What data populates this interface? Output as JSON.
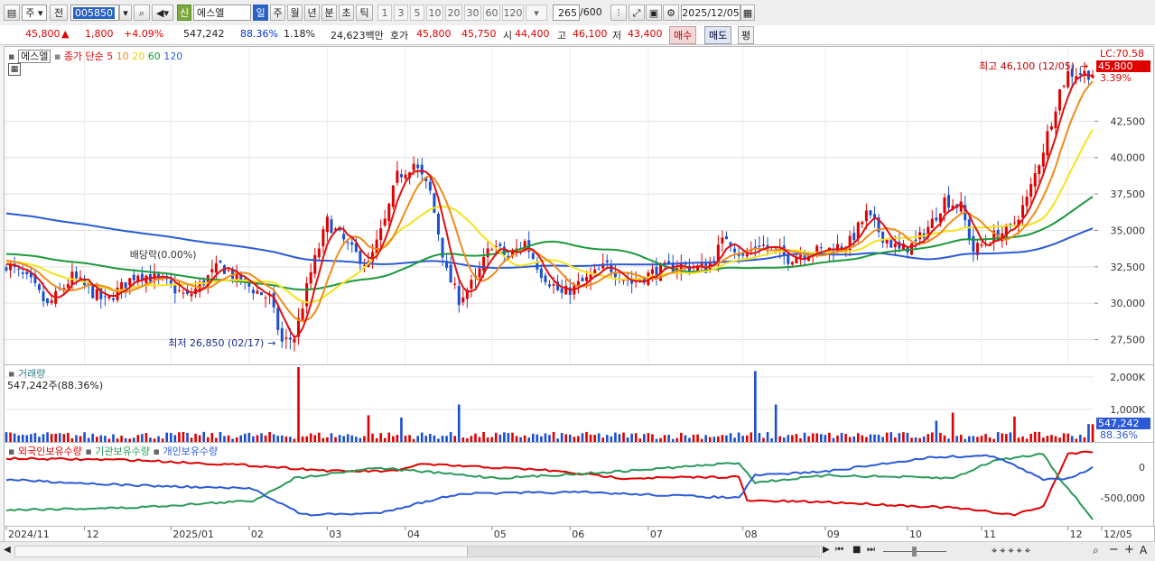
{
  "toolbar": {
    "type_label": "주",
    "jeon_label": "전",
    "code": "005850",
    "badge": "신",
    "name": "에스엘",
    "periods": [
      "일",
      "주",
      "월",
      "년",
      "분",
      "초",
      "틱"
    ],
    "active_period": "일",
    "minutes": [
      "1",
      "3",
      "5",
      "10",
      "20",
      "30",
      "60",
      "120"
    ],
    "count": "265",
    "count_total": "/600",
    "date": "2025/12/05"
  },
  "quote": {
    "price": "45,800",
    "arrow": "▲",
    "change": "1,800",
    "change_pct": "+4.09%",
    "volume": "547,242",
    "vol_ratio": "88.36%",
    "turnover": "1.18%",
    "amount": "24,623백만",
    "hoga_label": "호가",
    "ask": "45,800",
    "bid": "45,750",
    "open_label": "시",
    "open": "44,400",
    "high_label": "고",
    "high": "46,100",
    "low_label": "저",
    "low": "43,400",
    "buy_label": "매수",
    "sell_label": "매도",
    "eval_label": "평"
  },
  "legend_main": {
    "name": "에스엘",
    "ma_label": "종가 단순",
    "ma": [
      "5",
      "10",
      "20",
      "60",
      "120"
    ]
  },
  "annotations": {
    "lc": "LC:70.58",
    "high_note": "최고 46,100 (12/05)",
    "low_note": "최저 26,850 (02/17)",
    "dividend": "배당락(0.00%)",
    "last_price": "45,800",
    "last_pct": "3.39%"
  },
  "volume_panel": {
    "title": "거래량",
    "summary": "547,242주(88.36%)",
    "last": "547,242",
    "last_pct": "88.36%"
  },
  "holding_panel": {
    "legend": [
      "외국인보유수량",
      "기관보유수량",
      "개인보유수량"
    ]
  },
  "colors": {
    "up": "#e00000",
    "down": "#1a4fd0",
    "ma5": "#e01010",
    "ma10": "#f08c1a",
    "ma20": "#f5e31a",
    "ma60": "#1a9a3a",
    "ma120": "#2a5ad8",
    "foreign": "#e00000",
    "institution": "#2a9a5a",
    "individual": "#2a5ad8"
  },
  "chart_data": [
    {
      "type": "candlestick",
      "title": "에스엘",
      "y_ticks": [
        27500,
        30000,
        32500,
        35000,
        37500,
        40000,
        42500
      ],
      "y_tick_labels": [
        "27,500",
        "30,000",
        "32,500",
        "35,000",
        "37,500",
        "40,000",
        "42,500"
      ],
      "ylim": [
        25800,
        47600
      ],
      "x_ticks": [
        {
          "i": 0,
          "label": "2024/11"
        },
        {
          "i": 19,
          "label": "12"
        },
        {
          "i": 40,
          "label": "2025/01"
        },
        {
          "i": 59,
          "label": "02"
        },
        {
          "i": 78,
          "label": "03"
        },
        {
          "i": 97,
          "label": "04"
        },
        {
          "i": 118,
          "label": "05"
        },
        {
          "i": 137,
          "label": "06"
        },
        {
          "i": 156,
          "label": "07"
        },
        {
          "i": 179,
          "label": "08"
        },
        {
          "i": 199,
          "label": "09"
        },
        {
          "i": 219,
          "label": "10"
        },
        {
          "i": 237,
          "label": "11"
        },
        {
          "i": 258,
          "label": "12"
        },
        {
          "i": 270,
          "label": "12/05"
        }
      ],
      "close_anchors": [
        [
          0,
          32700
        ],
        [
          6,
          31400
        ],
        [
          10,
          29800
        ],
        [
          16,
          31800
        ],
        [
          24,
          30100
        ],
        [
          32,
          32100
        ],
        [
          38,
          31500
        ],
        [
          44,
          30400
        ],
        [
          52,
          32600
        ],
        [
          58,
          31300
        ],
        [
          64,
          30300
        ],
        [
          67,
          27300
        ],
        [
          70,
          27700
        ],
        [
          74,
          32100
        ],
        [
          78,
          35600
        ],
        [
          84,
          33600
        ],
        [
          88,
          32600
        ],
        [
          92,
          35600
        ],
        [
          95,
          38700
        ],
        [
          99,
          39600
        ],
        [
          103,
          37600
        ],
        [
          107,
          32100
        ],
        [
          110,
          30300
        ],
        [
          114,
          31600
        ],
        [
          118,
          34100
        ],
        [
          122,
          33100
        ],
        [
          126,
          34200
        ],
        [
          130,
          32100
        ],
        [
          135,
          30600
        ],
        [
          141,
          31600
        ],
        [
          146,
          32600
        ],
        [
          152,
          31400
        ],
        [
          157,
          32100
        ],
        [
          163,
          32600
        ],
        [
          170,
          32400
        ],
        [
          175,
          34600
        ],
        [
          179,
          33100
        ],
        [
          183,
          34100
        ],
        [
          190,
          33100
        ],
        [
          195,
          33600
        ],
        [
          199,
          33600
        ],
        [
          205,
          34200
        ],
        [
          209,
          36100
        ],
        [
          213,
          34600
        ],
        [
          217,
          33600
        ],
        [
          221,
          34100
        ],
        [
          225,
          35600
        ],
        [
          228,
          37100
        ],
        [
          232,
          36600
        ],
        [
          235,
          33600
        ],
        [
          240,
          34600
        ],
        [
          244,
          35100
        ],
        [
          248,
          37100
        ],
        [
          252,
          40600
        ],
        [
          256,
          44600
        ],
        [
          258,
          45800
        ]
      ],
      "ma_start": {
        "ma5": 32800,
        "ma10": 33000,
        "ma20": 32900,
        "ma60": 33400,
        "ma120": 36200
      },
      "highest": {
        "value": 46100,
        "date": "12/05"
      },
      "lowest": {
        "value": 26850,
        "date": "02/17"
      }
    },
    {
      "type": "bar",
      "title": "거래량",
      "y_ticks": [
        1000000,
        2000000
      ],
      "y_tick_labels": [
        "1,000K",
        "2,000K"
      ],
      "ylim": [
        0,
        2300000
      ],
      "spikes": [
        [
          71,
          2300000
        ],
        [
          110,
          1150000
        ],
        [
          182,
          2180000
        ],
        [
          187,
          1150000
        ],
        [
          230,
          900000
        ],
        [
          245,
          780000
        ],
        [
          88,
          820000
        ],
        [
          96,
          750000
        ],
        [
          226,
          650000
        ],
        [
          263,
          550000
        ]
      ],
      "last_value": 547242
    },
    {
      "type": "line",
      "title": "보유수량",
      "y_ticks": [
        0,
        -500000
      ],
      "y_tick_labels": [
        "0",
        "-500,000"
      ],
      "ylim": [
        -800000,
        150000
      ],
      "series": [
        {
          "name": "외국인보유수량",
          "anchors": [
            [
              0,
              0.12
            ],
            [
              30,
              0.14
            ],
            [
              60,
              0.22
            ],
            [
              80,
              0.3
            ],
            [
              95,
              0.3
            ],
            [
              100,
              0.2
            ],
            [
              130,
              0.28
            ],
            [
              150,
              0.4
            ],
            [
              178,
              0.38
            ],
            [
              180,
              0.72
            ],
            [
              200,
              0.74
            ],
            [
              230,
              0.82
            ],
            [
              245,
              0.92
            ],
            [
              252,
              0.8
            ],
            [
              258,
              0.05
            ],
            [
              264,
              0.02
            ]
          ]
        },
        {
          "name": "기관보유수량",
          "anchors": [
            [
              0,
              0.85
            ],
            [
              30,
              0.82
            ],
            [
              60,
              0.72
            ],
            [
              70,
              0.4
            ],
            [
              90,
              0.25
            ],
            [
              120,
              0.4
            ],
            [
              150,
              0.3
            ],
            [
              178,
              0.18
            ],
            [
              182,
              0.46
            ],
            [
              200,
              0.36
            ],
            [
              230,
              0.4
            ],
            [
              240,
              0.15
            ],
            [
              252,
              0.05
            ],
            [
              256,
              0.4
            ],
            [
              264,
              0.98
            ]
          ]
        },
        {
          "name": "개인보유수량",
          "anchors": [
            [
              0,
              0.42
            ],
            [
              30,
              0.5
            ],
            [
              60,
              0.55
            ],
            [
              72,
              0.92
            ],
            [
              90,
              0.9
            ],
            [
              110,
              0.62
            ],
            [
              140,
              0.6
            ],
            [
              178,
              0.68
            ],
            [
              182,
              0.36
            ],
            [
              200,
              0.3
            ],
            [
              225,
              0.1
            ],
            [
              240,
              0.08
            ],
            [
              252,
              0.42
            ],
            [
              258,
              0.4
            ],
            [
              264,
              0.25
            ]
          ]
        }
      ]
    }
  ]
}
